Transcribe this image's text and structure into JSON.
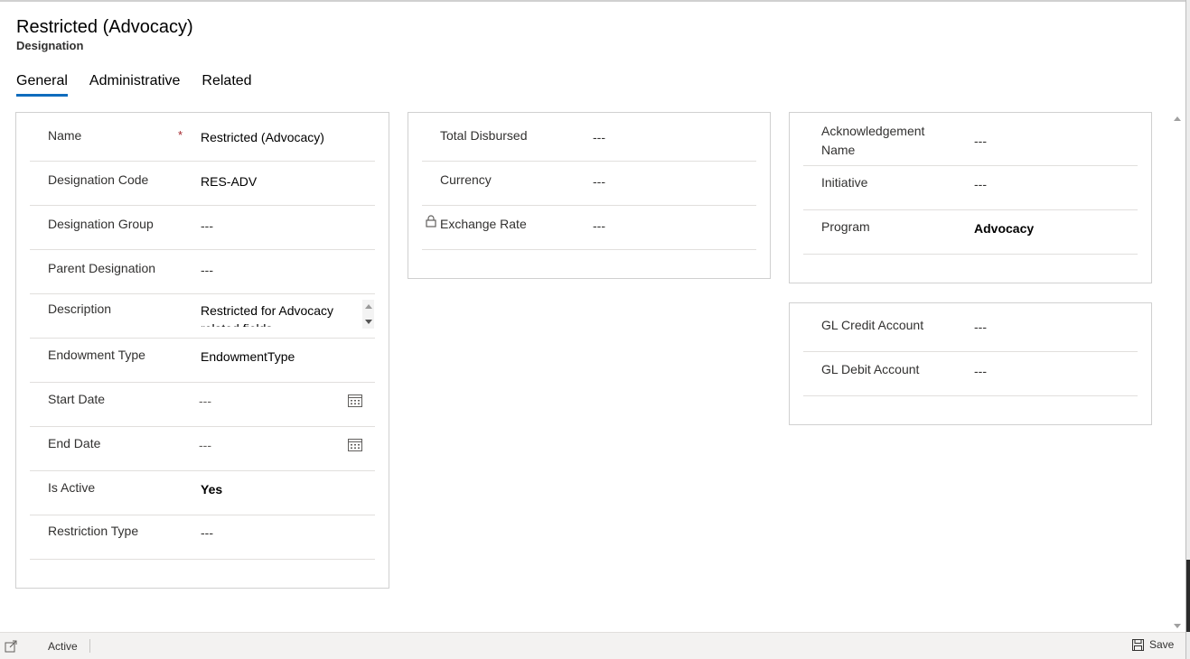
{
  "record": {
    "title": "Restricted (Advocacy)",
    "entity": "Designation"
  },
  "tabs": [
    {
      "label": "General",
      "active": true
    },
    {
      "label": "Administrative",
      "active": false
    },
    {
      "label": "Related",
      "active": false
    }
  ],
  "general_section": {
    "fields": {
      "name": {
        "label": "Name",
        "value": "Restricted (Advocacy)",
        "required_mark": "*"
      },
      "designation_code": {
        "label": "Designation Code",
        "value": "RES-ADV"
      },
      "designation_group": {
        "label": "Designation Group",
        "value": "---"
      },
      "parent_designation": {
        "label": "Parent Designation",
        "value": "---"
      },
      "description": {
        "label": "Description",
        "value": "Restricted for Advocacy related fields"
      },
      "endowment_type": {
        "label": "Endowment Type",
        "value": "EndowmentType"
      },
      "start_date": {
        "label": "Start Date",
        "value": "---"
      },
      "end_date": {
        "label": "End Date",
        "value": "---"
      },
      "is_active": {
        "label": "Is Active",
        "value": "Yes"
      },
      "restriction_type": {
        "label": "Restriction Type",
        "value": "---"
      }
    }
  },
  "financial_section": {
    "fields": {
      "total_disbursed": {
        "label": "Total Disbursed",
        "value": "---"
      },
      "currency": {
        "label": "Currency",
        "value": "---"
      },
      "exchange_rate": {
        "label": "Exchange Rate",
        "value": "---",
        "locked": true
      }
    }
  },
  "program_section": {
    "fields": {
      "acknowledgement_name": {
        "label_line1": "Acknowledgement",
        "label_line2": "Name",
        "value": "---"
      },
      "initiative": {
        "label": "Initiative",
        "value": "---"
      },
      "program": {
        "label": "Program",
        "value": "Advocacy"
      }
    }
  },
  "gl_section": {
    "fields": {
      "gl_credit_account": {
        "label": "GL Credit Account",
        "value": "---"
      },
      "gl_debit_account": {
        "label": "GL Debit Account",
        "value": "---"
      }
    }
  },
  "footer": {
    "status": "Active",
    "save_label": "Save"
  },
  "colors": {
    "accent": "#0f6cbd",
    "required": "#a4262c"
  }
}
